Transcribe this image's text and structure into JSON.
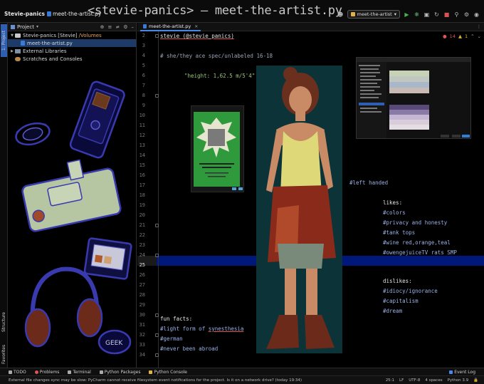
{
  "window": {
    "project_name": "Stevie-panics",
    "file_name": "meet-the-artist.py",
    "title": "<stevie-panics> – meet-the-artist.py",
    "run_config": "meet-the-artist"
  },
  "left_strip": {
    "project_tab": "1: Project",
    "structure_tab": "Structure",
    "favorites_tab": "Favorites"
  },
  "project_panel": {
    "header": "Project",
    "tree": [
      {
        "label": "Stevie-panics [Stevie]",
        "path": "/Volumes"
      },
      {
        "label": "meet-the-artist.py"
      },
      {
        "label": "External Libraries"
      },
      {
        "label": "Scratches and Consoles"
      }
    ]
  },
  "editor": {
    "tab_label": "meet-the-artist.py",
    "inspection": {
      "errors": "14",
      "warnings": "1"
    },
    "line_numbers": [
      "2",
      "3",
      "4",
      "5",
      "6",
      "7",
      "8",
      "9",
      "10",
      "11",
      "12",
      "13",
      "14",
      "15",
      "16",
      "17",
      "18",
      "19",
      "20",
      "21",
      "22",
      "23",
      "24",
      "25",
      "26",
      "27",
      "28",
      "29",
      "30",
      "31",
      "32",
      "33",
      "34"
    ],
    "code": {
      "l2": "stevie (@stevie_panics)",
      "l4": "# she/they   ace spec/unlabeled   16-18",
      "l6": "\"height: 1,62.5 m/5'4\"",
      "left_handed": "#left handed",
      "likes_title": "likes:",
      "likes": [
        "#colors",
        "#privacy and honesty",
        "#tank tops",
        "#wine red,orange,teal",
        "#owengejuiceTV rats SMP"
      ],
      "dislikes_title": "dislikes:",
      "dislikes": [
        "#idiocy/ignorance",
        "#capitalism",
        "#dream"
      ],
      "fun_facts_title": "fun facts:",
      "fun_prefix": "#light form of ",
      "fun_synesthesia": "synesthesia",
      "fun_facts": [
        "#german",
        "#never been abroad"
      ]
    }
  },
  "toolwindows": [
    "TODO",
    "Problems",
    "Terminal",
    "Python Packages",
    "Python Console"
  ],
  "event_log": "Event Log",
  "status": {
    "message": "External file changes sync may be slow: PyCharm cannot receive filesystem event notifications for the project. Is it on a network drive? (today 19:34)",
    "position": "25:1",
    "line_sep": "LF",
    "encoding": "UTF-8",
    "indent": "4 spaces",
    "interpreter": "Python 3.9"
  },
  "colors": {
    "accent": "#2f5fb3",
    "current_line": "#00187a",
    "portrait_bg": "#0b3338"
  }
}
